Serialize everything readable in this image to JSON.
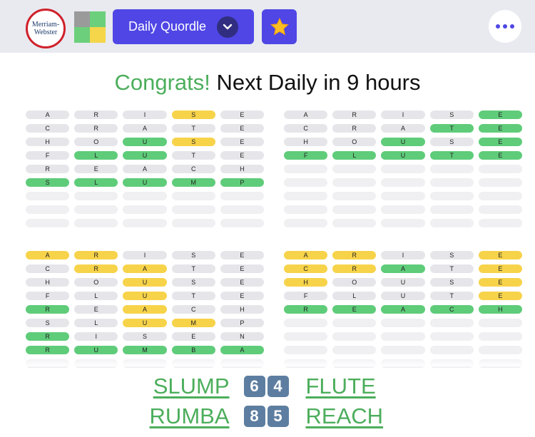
{
  "header": {
    "logo_line1": "Merriam-",
    "logo_line2": "Webster",
    "dropdown_label": "Daily Quordle"
  },
  "status": {
    "congrats": "Congrats!",
    "next": "Next Daily in 9 hours"
  },
  "boards": [
    {
      "rows": [
        [
          [
            "A",
            "n"
          ],
          [
            "R",
            "n"
          ],
          [
            "I",
            "n"
          ],
          [
            "S",
            "y"
          ],
          [
            "E",
            "n"
          ]
        ],
        [
          [
            "C",
            "n"
          ],
          [
            "R",
            "n"
          ],
          [
            "A",
            "n"
          ],
          [
            "T",
            "n"
          ],
          [
            "E",
            "n"
          ]
        ],
        [
          [
            "H",
            "n"
          ],
          [
            "O",
            "n"
          ],
          [
            "U",
            "g"
          ],
          [
            "S",
            "y"
          ],
          [
            "E",
            "n"
          ]
        ],
        [
          [
            "F",
            "n"
          ],
          [
            "L",
            "g"
          ],
          [
            "U",
            "g"
          ],
          [
            "T",
            "n"
          ],
          [
            "E",
            "n"
          ]
        ],
        [
          [
            "R",
            "n"
          ],
          [
            "E",
            "n"
          ],
          [
            "A",
            "n"
          ],
          [
            "C",
            "n"
          ],
          [
            "H",
            "n"
          ]
        ],
        [
          [
            "S",
            "g"
          ],
          [
            "L",
            "g"
          ],
          [
            "U",
            "g"
          ],
          [
            "M",
            "g"
          ],
          [
            "P",
            "g"
          ]
        ],
        [
          [
            "",
            "e"
          ],
          [
            "",
            "e"
          ],
          [
            "",
            "e"
          ],
          [
            "",
            "e"
          ],
          [
            "",
            "e"
          ]
        ],
        [
          [
            "",
            "e"
          ],
          [
            "",
            "e"
          ],
          [
            "",
            "e"
          ],
          [
            "",
            "e"
          ],
          [
            "",
            "e"
          ]
        ],
        [
          [
            "",
            "e"
          ],
          [
            "",
            "e"
          ],
          [
            "",
            "e"
          ],
          [
            "",
            "e"
          ],
          [
            "",
            "e"
          ]
        ]
      ]
    },
    {
      "rows": [
        [
          [
            "A",
            "n"
          ],
          [
            "R",
            "n"
          ],
          [
            "I",
            "n"
          ],
          [
            "S",
            "n"
          ],
          [
            "E",
            "g"
          ]
        ],
        [
          [
            "C",
            "n"
          ],
          [
            "R",
            "n"
          ],
          [
            "A",
            "n"
          ],
          [
            "T",
            "g"
          ],
          [
            "E",
            "g"
          ]
        ],
        [
          [
            "H",
            "n"
          ],
          [
            "O",
            "n"
          ],
          [
            "U",
            "g"
          ],
          [
            "S",
            "n"
          ],
          [
            "E",
            "g"
          ]
        ],
        [
          [
            "F",
            "g"
          ],
          [
            "L",
            "g"
          ],
          [
            "U",
            "g"
          ],
          [
            "T",
            "g"
          ],
          [
            "E",
            "g"
          ]
        ],
        [
          [
            "",
            "e"
          ],
          [
            "",
            "e"
          ],
          [
            "",
            "e"
          ],
          [
            "",
            "e"
          ],
          [
            "",
            "e"
          ]
        ],
        [
          [
            "",
            "e"
          ],
          [
            "",
            "e"
          ],
          [
            "",
            "e"
          ],
          [
            "",
            "e"
          ],
          [
            "",
            "e"
          ]
        ],
        [
          [
            "",
            "e"
          ],
          [
            "",
            "e"
          ],
          [
            "",
            "e"
          ],
          [
            "",
            "e"
          ],
          [
            "",
            "e"
          ]
        ],
        [
          [
            "",
            "e"
          ],
          [
            "",
            "e"
          ],
          [
            "",
            "e"
          ],
          [
            "",
            "e"
          ],
          [
            "",
            "e"
          ]
        ],
        [
          [
            "",
            "e"
          ],
          [
            "",
            "e"
          ],
          [
            "",
            "e"
          ],
          [
            "",
            "e"
          ],
          [
            "",
            "e"
          ]
        ]
      ]
    },
    {
      "rows": [
        [
          [
            "A",
            "y"
          ],
          [
            "R",
            "y"
          ],
          [
            "I",
            "n"
          ],
          [
            "S",
            "n"
          ],
          [
            "E",
            "n"
          ]
        ],
        [
          [
            "C",
            "n"
          ],
          [
            "R",
            "y"
          ],
          [
            "A",
            "y"
          ],
          [
            "T",
            "n"
          ],
          [
            "E",
            "n"
          ]
        ],
        [
          [
            "H",
            "n"
          ],
          [
            "O",
            "n"
          ],
          [
            "U",
            "y"
          ],
          [
            "S",
            "n"
          ],
          [
            "E",
            "n"
          ]
        ],
        [
          [
            "F",
            "n"
          ],
          [
            "L",
            "n"
          ],
          [
            "U",
            "y"
          ],
          [
            "T",
            "n"
          ],
          [
            "E",
            "n"
          ]
        ],
        [
          [
            "R",
            "g"
          ],
          [
            "E",
            "n"
          ],
          [
            "A",
            "y"
          ],
          [
            "C",
            "n"
          ],
          [
            "H",
            "n"
          ]
        ],
        [
          [
            "S",
            "n"
          ],
          [
            "L",
            "n"
          ],
          [
            "U",
            "y"
          ],
          [
            "M",
            "y"
          ],
          [
            "P",
            "n"
          ]
        ],
        [
          [
            "R",
            "g"
          ],
          [
            "I",
            "n"
          ],
          [
            "S",
            "n"
          ],
          [
            "E",
            "n"
          ],
          [
            "N",
            "n"
          ]
        ],
        [
          [
            "R",
            "g"
          ],
          [
            "U",
            "g"
          ],
          [
            "M",
            "g"
          ],
          [
            "B",
            "g"
          ],
          [
            "A",
            "g"
          ]
        ],
        [
          [
            "",
            "e"
          ],
          [
            "",
            "e"
          ],
          [
            "",
            "e"
          ],
          [
            "",
            "e"
          ],
          [
            "",
            "e"
          ]
        ]
      ]
    },
    {
      "rows": [
        [
          [
            "A",
            "y"
          ],
          [
            "R",
            "y"
          ],
          [
            "I",
            "n"
          ],
          [
            "S",
            "n"
          ],
          [
            "E",
            "y"
          ]
        ],
        [
          [
            "C",
            "y"
          ],
          [
            "R",
            "y"
          ],
          [
            "A",
            "g"
          ],
          [
            "T",
            "n"
          ],
          [
            "E",
            "y"
          ]
        ],
        [
          [
            "H",
            "y"
          ],
          [
            "O",
            "n"
          ],
          [
            "U",
            "n"
          ],
          [
            "S",
            "n"
          ],
          [
            "E",
            "y"
          ]
        ],
        [
          [
            "F",
            "n"
          ],
          [
            "L",
            "n"
          ],
          [
            "U",
            "n"
          ],
          [
            "T",
            "n"
          ],
          [
            "E",
            "y"
          ]
        ],
        [
          [
            "R",
            "g"
          ],
          [
            "E",
            "g"
          ],
          [
            "A",
            "g"
          ],
          [
            "C",
            "g"
          ],
          [
            "H",
            "g"
          ]
        ],
        [
          [
            "",
            "e"
          ],
          [
            "",
            "e"
          ],
          [
            "",
            "e"
          ],
          [
            "",
            "e"
          ],
          [
            "",
            "e"
          ]
        ],
        [
          [
            "",
            "e"
          ],
          [
            "",
            "e"
          ],
          [
            "",
            "e"
          ],
          [
            "",
            "e"
          ],
          [
            "",
            "e"
          ]
        ],
        [
          [
            "",
            "e"
          ],
          [
            "",
            "e"
          ],
          [
            "",
            "e"
          ],
          [
            "",
            "e"
          ],
          [
            "",
            "e"
          ]
        ],
        [
          [
            "",
            "e"
          ],
          [
            "",
            "e"
          ],
          [
            "",
            "e"
          ],
          [
            "",
            "e"
          ],
          [
            "",
            "e"
          ]
        ]
      ]
    }
  ],
  "summary": [
    {
      "left_word": "SLUMP",
      "left_num": "6",
      "right_num": "4",
      "right_word": "FLUTE"
    },
    {
      "left_word": "RUMBA",
      "left_num": "8",
      "right_num": "5",
      "right_word": "REACH"
    }
  ],
  "colors": {
    "accent": "#4f46e5",
    "correct": "#5fcc7a",
    "present": "#f7d34a",
    "absent": "#e6e6ea"
  }
}
